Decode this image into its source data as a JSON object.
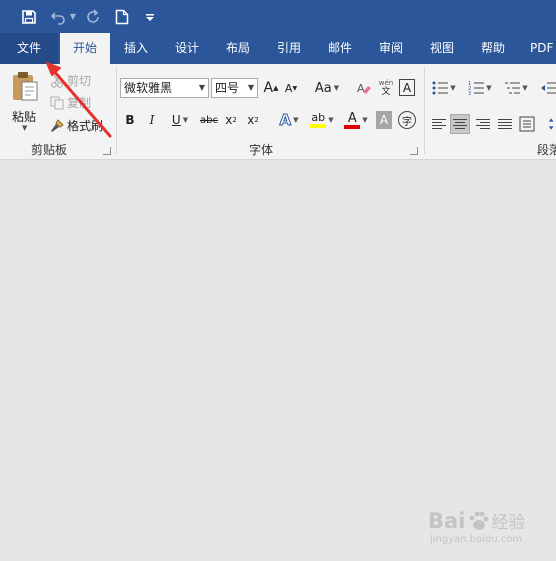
{
  "qat": {
    "save_icon": "save-icon",
    "undo_icon": "undo-icon",
    "redo_icon": "redo-icon",
    "new_icon": "new-document-icon",
    "customize_icon": "customize-qat-icon"
  },
  "tabs": [
    {
      "label": "文件"
    },
    {
      "label": "开始"
    },
    {
      "label": "插入"
    },
    {
      "label": "设计"
    },
    {
      "label": "布局"
    },
    {
      "label": "引用"
    },
    {
      "label": "邮件"
    },
    {
      "label": "审阅"
    },
    {
      "label": "视图"
    },
    {
      "label": "帮助"
    },
    {
      "label": "PDF"
    }
  ],
  "clipboard": {
    "paste": "粘贴",
    "cut": "剪切",
    "copy": "复制",
    "format_painter": "格式刷",
    "group": "剪贴板"
  },
  "font": {
    "name": "微软雅黑",
    "size": "四号",
    "group": "字体",
    "grow": "A",
    "shrink": "A",
    "case": "Aa",
    "bold": "B",
    "italic": "I",
    "underline": "U",
    "strike": "abc",
    "sub": "x",
    "sup": "x",
    "text_effect": "A",
    "highlight": "ab",
    "font_color": "A",
    "char_shading": "A",
    "char_border": "A",
    "enclose": "字",
    "phonetic_a": "wén",
    "phonetic_b": "文"
  },
  "paragraph": {
    "group": "段落"
  },
  "accent": "#2b579a",
  "annotation": {
    "arrow_color": "#e5322d"
  },
  "watermark": {
    "brand": "Bai",
    "brand_suffix": "经验",
    "url": "jingyan.baidu.com"
  }
}
